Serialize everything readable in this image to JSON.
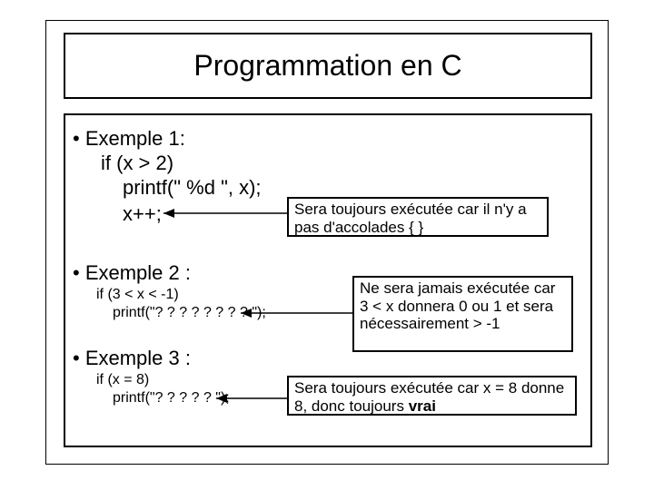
{
  "title": "Programmation en C",
  "ex1": {
    "bullet": "• Exemple 1:",
    "line1": "if (x > 2)",
    "line2": "printf(\" %d \", x);",
    "line3": "x++;",
    "note": "Sera toujours exécutée car il n'y a pas d'accolades {  }"
  },
  "ex2": {
    "bullet": "• Exemple 2 :",
    "line1": "if (3 < x < -1)",
    "line2": "printf(\"? ? ? ? ? ? ? ? \");",
    "note": "Ne sera jamais exécutée car 3 < x donnera 0 ou 1 et sera nécessairement > -1"
  },
  "ex3": {
    "bullet": "• Exemple 3 :",
    "line1": "if (x = 8)",
    "line2": "printf(\"? ? ? ? ? \");",
    "note_prefix": "Sera toujours exécutée car x = 8 donne 8, donc toujours ",
    "note_bold": "vrai"
  }
}
